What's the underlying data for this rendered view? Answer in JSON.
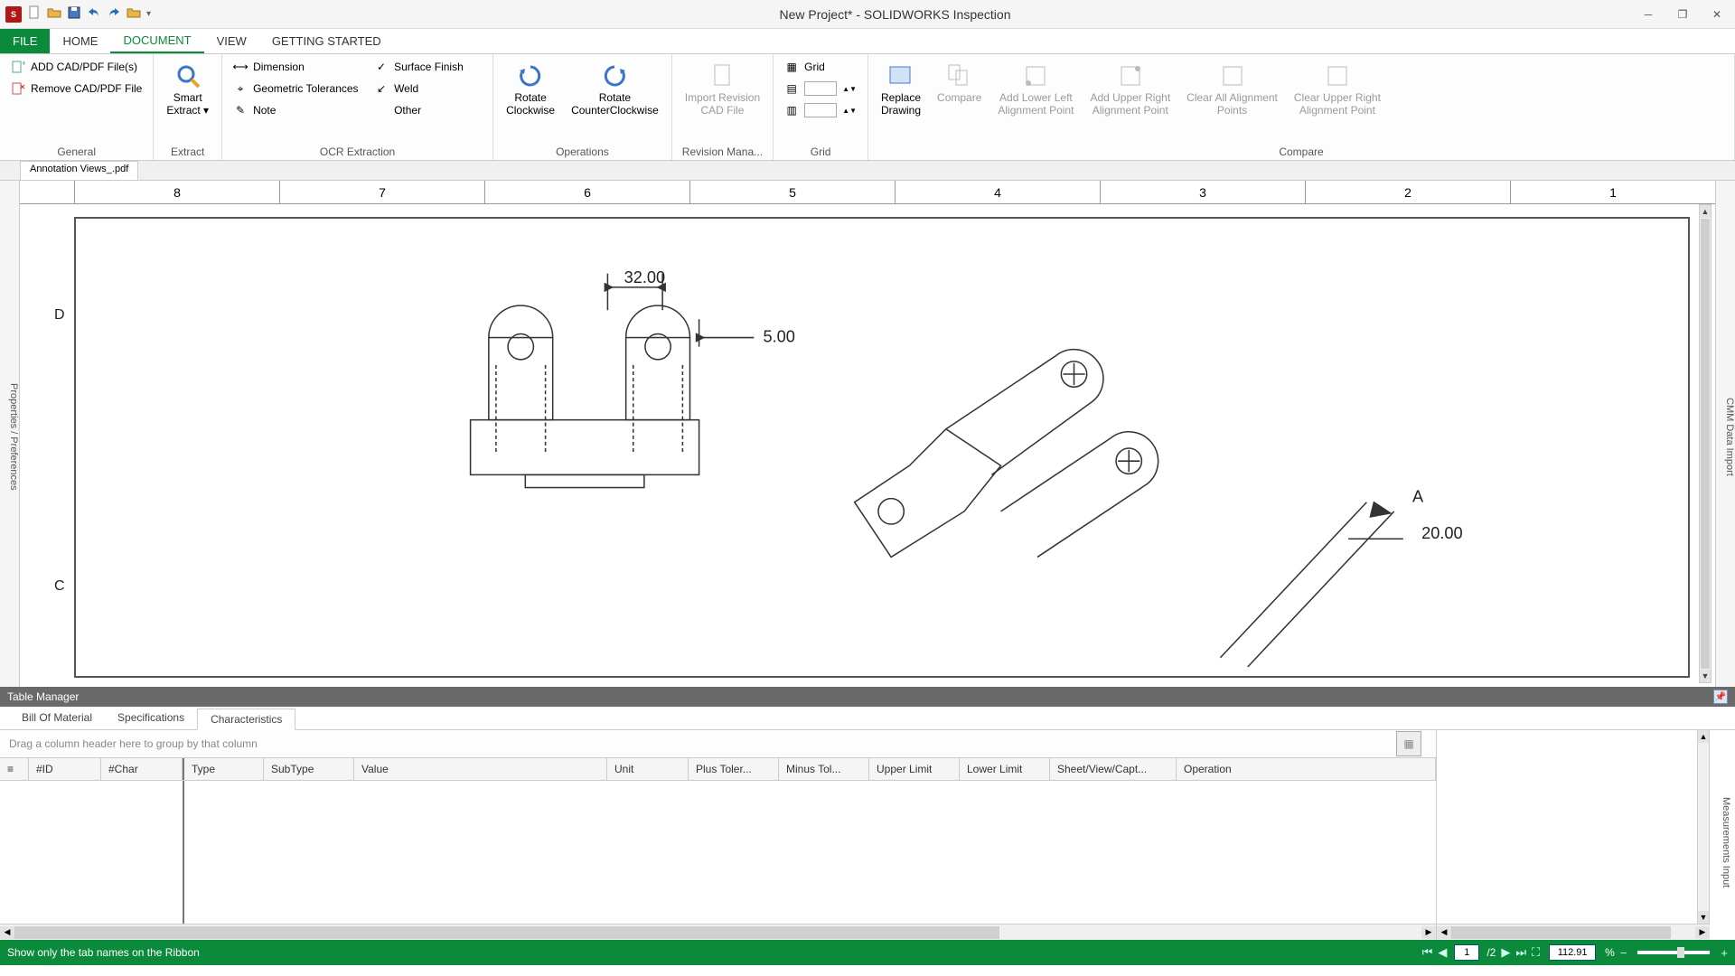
{
  "title": "New Project* - SOLIDWORKS Inspection",
  "tabs": {
    "file": "FILE",
    "home": "HOME",
    "document": "DOCUMENT",
    "view": "VIEW",
    "getting_started": "GETTING STARTED"
  },
  "ribbon": {
    "general": {
      "add": "ADD CAD/PDF File(s)",
      "remove": "Remove CAD/PDF File",
      "label": "General"
    },
    "extract": {
      "smart1": "Smart",
      "smart2": "Extract ▾",
      "label": "Extract"
    },
    "ocr": {
      "dimension": "Dimension",
      "geotol": "Geometric Tolerances",
      "note": "Note",
      "surface": "Surface Finish",
      "weld": "Weld",
      "other": "Other",
      "label": "OCR Extraction"
    },
    "ops": {
      "rotcw1": "Rotate",
      "rotcw2": "Clockwise",
      "rotccw1": "Rotate",
      "rotccw2": "CounterClockwise",
      "label": "Operations"
    },
    "rev": {
      "import1": "Import Revision",
      "import2": "CAD File",
      "label": "Revision Mana..."
    },
    "grid": {
      "grid": "Grid",
      "label": "Grid"
    },
    "compare": {
      "replace1": "Replace",
      "replace2": "Drawing",
      "compare": "Compare",
      "addll1": "Add Lower Left",
      "addll2": "Alignment Point",
      "addur1": "Add Upper Right",
      "addur2": "Alignment Point",
      "clearall1": "Clear All Alignment",
      "clearall2": "Points",
      "clearur1": "Clear Upper Right",
      "clearur2": "Alignment Point",
      "label": "Compare"
    }
  },
  "doctab": "Annotation Views_.pdf",
  "left_panel": "Properties / Preferences",
  "right_panel": "CMM Data Import",
  "ruler": [
    "8",
    "7",
    "6",
    "5",
    "4",
    "3",
    "2",
    "1"
  ],
  "row_labels": {
    "D": "D",
    "C": "C"
  },
  "drawing": {
    "dim1": "32.00",
    "dim2": "5.00",
    "dim3": "20.00",
    "ref_a": "A"
  },
  "table_manager": {
    "title": "Table Manager",
    "tabs": {
      "bom": "Bill Of Material",
      "specs": "Specifications",
      "chars": "Characteristics"
    },
    "group_hint": "Drag a column header here to group by that column",
    "cols": {
      "id": "#ID",
      "char": "#Char",
      "type": "Type",
      "subtype": "SubType",
      "value": "Value",
      "unit": "Unit",
      "plustol": "Plus Toler...",
      "minustol": "Minus Tol...",
      "upper": "Upper Limit",
      "lower": "Lower Limit",
      "sheet": "Sheet/View/Capt...",
      "op": "Operation"
    },
    "meas_input": "Measurements Input"
  },
  "status": {
    "hint": "Show only the tab names on the Ribbon",
    "page": "1",
    "pages": "/2",
    "zoom": "112.91",
    "zoom_unit": "%"
  }
}
